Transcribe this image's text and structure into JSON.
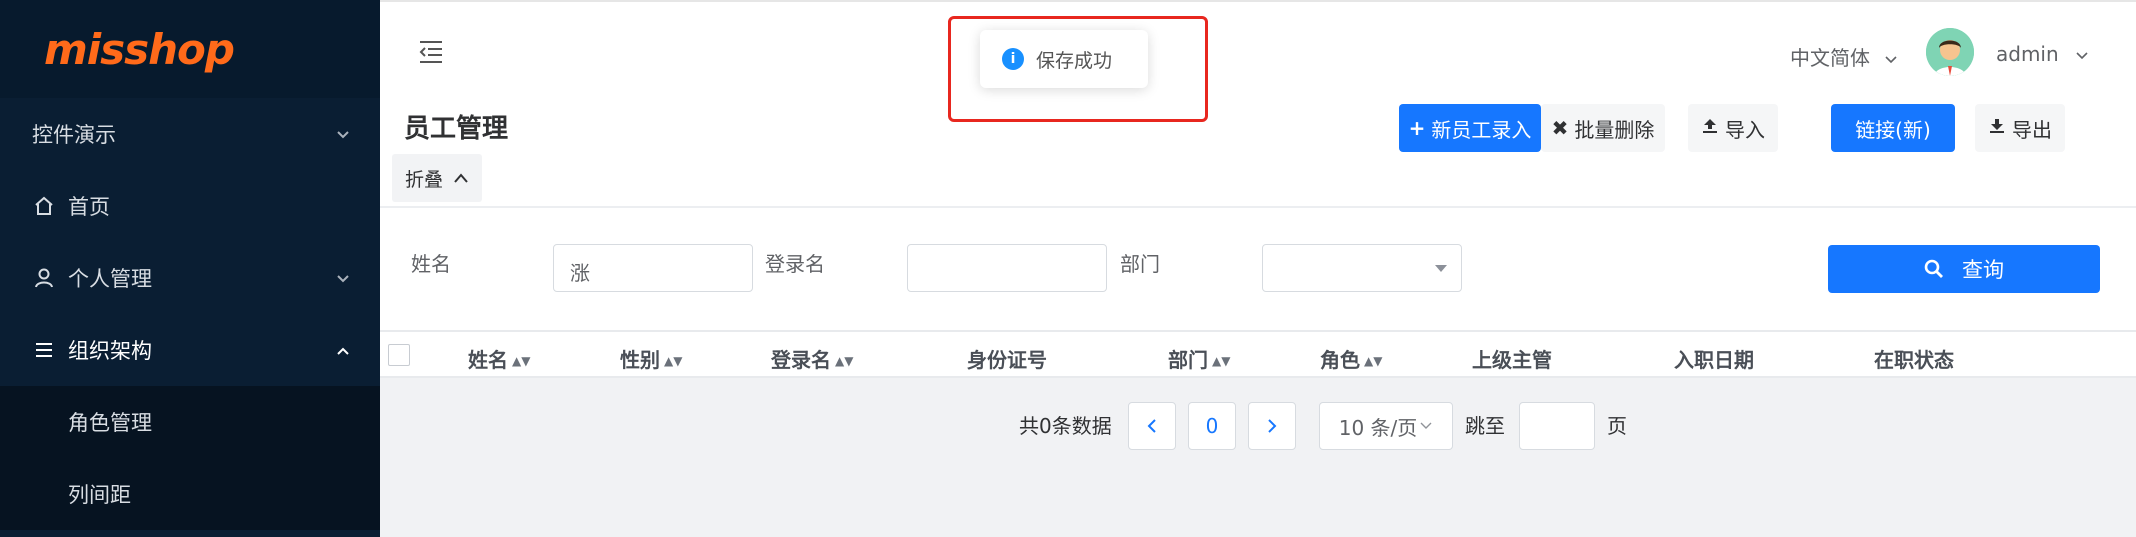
{
  "app": {
    "logo": "misshop"
  },
  "sidebar": {
    "items": [
      {
        "label": "控件演示",
        "icon": "none",
        "arrow": "chevron-down"
      },
      {
        "label": "首页",
        "icon": "home-icon"
      },
      {
        "label": "个人管理",
        "icon": "user-icon",
        "arrow": "chevron-down"
      },
      {
        "label": "组织架构",
        "icon": "menu-icon",
        "arrow": "chevron-up",
        "open": true,
        "children": [
          {
            "label": "角色管理"
          },
          {
            "label": "列间距"
          }
        ]
      }
    ]
  },
  "header": {
    "language": "中文简体",
    "username": "admin"
  },
  "toast": {
    "message": "保存成功",
    "icon": "info-icon",
    "highlight_color": "#e8271f"
  },
  "page": {
    "title": "员工管理",
    "collapse_label": "折叠"
  },
  "toolbar": {
    "add_label": "新员工录入",
    "batch_delete_label": "批量删除",
    "import_label": "导入",
    "link_label": "链接(新)",
    "export_label": "导出"
  },
  "search": {
    "name_label": "姓名",
    "name_value": "涨",
    "login_label": "登录名",
    "login_value": "",
    "dept_label": "部门",
    "dept_value": "",
    "query_label": "查询"
  },
  "table": {
    "columns": [
      "姓名",
      "性别",
      "登录名",
      "身份证号",
      "部门",
      "角色",
      "上级主管",
      "入职日期",
      "在职状态"
    ],
    "sortable": [
      true,
      true,
      true,
      false,
      true,
      true,
      false,
      false,
      false
    ],
    "rows": []
  },
  "pagination": {
    "total_text": "共0条数据",
    "current_page": "0",
    "page_size": "10 条/页",
    "jump_label": "跳至",
    "page_suffix": "页"
  },
  "colors": {
    "sidebar_bg": "#0a1e33",
    "primary": "#1677ff",
    "logo": "#ff6a1a"
  }
}
